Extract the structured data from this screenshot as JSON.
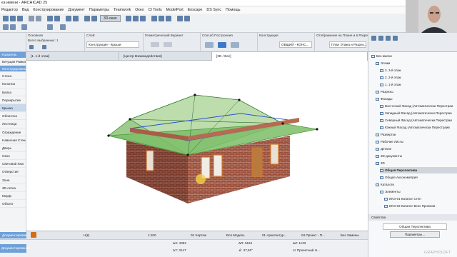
{
  "window": {
    "title": "ез имени - ARCHICAD 25"
  },
  "menu": [
    "Редактор",
    "Вид",
    "Конструирование",
    "Документ",
    "Параметры",
    "Teamwork",
    "Окно",
    "CI Tools",
    "ModelPort",
    "Enscape",
    "DS Sync",
    "Помощь"
  ],
  "toolbar": {
    "view3d_label": "3D-окно"
  },
  "infobox": {
    "main_header": "Основная",
    "selected": "Всего выбранных: 1",
    "layer_header": "Слой:",
    "layer_value": "Конструкция - Крыши",
    "geometry_header": "Геометрический Вариант",
    "method_header": "Способ Построения",
    "construction_header": "Конструкция",
    "construction_value": "ОБЩИЙ - КОНС...",
    "display_header": "Отображение на Плане и в Разрезе",
    "display_value": "План Этажа и Разрез..."
  },
  "toolbox": {
    "header": "Указатель",
    "items": [
      "Бегущая Рамка",
      "Конструирование",
      "Стена",
      "Колонна",
      "Балка",
      "Перекрытие",
      "Крыша",
      "Оболочка",
      "Лестница",
      "Ограждение",
      "Навесная Стена",
      "Дверь",
      "Окно",
      "Световой Люк",
      "Отверстие",
      "Зона",
      "3D-сетка",
      "Морф",
      "Объект"
    ],
    "bottom": "Документирование"
  },
  "tabs": [
    {
      "label": "[1. 1-й этаж]",
      "active": false
    },
    {
      "label": "[Центр Взаимодействия]",
      "active": false
    },
    {
      "label": "[3D / Все]",
      "active": true
    }
  ],
  "status": {
    "scale": "1:100",
    "view": "02 Чертеж",
    "model": "Вся Модель",
    "arch": "01 Архитектур...",
    "project": "04 Проект - П...",
    "changes": "Без Замены"
  },
  "coords": {
    "dx": "ΔX: 4092",
    "dy": "ΔY: 3147",
    "dr": "ΔR: 5162",
    "angle": "∡: 37,50°",
    "dz": "ΔZ: 1133",
    "ref": "от Проектный Н..."
  },
  "navigator": {
    "project": "Без имени",
    "items": [
      {
        "label": "Этажи",
        "level": 1
      },
      {
        "label": "3. 3-й этаж",
        "level": 2
      },
      {
        "label": "2. 2-й этаж",
        "level": 2
      },
      {
        "label": "1. 1-й этаж",
        "level": 2
      },
      {
        "label": "Разрезы",
        "level": 1
      },
      {
        "label": "Фасады",
        "level": 1
      },
      {
        "label": "Восточный Фасад (Автоматически Перестраи",
        "level": 2
      },
      {
        "label": "Западный Фасад (Автоматически Перестраи",
        "level": 2
      },
      {
        "label": "Северный Фасад (Автоматически Перестраи",
        "level": 2
      },
      {
        "label": "Южный Фасад (Автоматически Перестраив",
        "level": 2
      },
      {
        "label": "Развертки",
        "level": 1
      },
      {
        "label": "Рабочие Листы",
        "level": 1
      },
      {
        "label": "Детали",
        "level": 1
      },
      {
        "label": "3D-документы",
        "level": 1
      },
      {
        "label": "3D",
        "level": 1
      },
      {
        "label": "Общая Перспектива",
        "level": 2,
        "selected": true
      },
      {
        "label": "Общая Аксонометрия",
        "level": 2
      },
      {
        "label": "Каталоги",
        "level": 1
      },
      {
        "label": "Элементы",
        "level": 2
      },
      {
        "label": "ИКЭ-01 Каталог Стен",
        "level": 3
      },
      {
        "label": "ИКЭ-02 Каталог Всех Проемов",
        "level": 3
      }
    ],
    "properties_label": "Свойства",
    "view_name": "Общая Перспектива",
    "params_button": "Параметры..."
  },
  "watermark": "GRAPHISOFT"
}
